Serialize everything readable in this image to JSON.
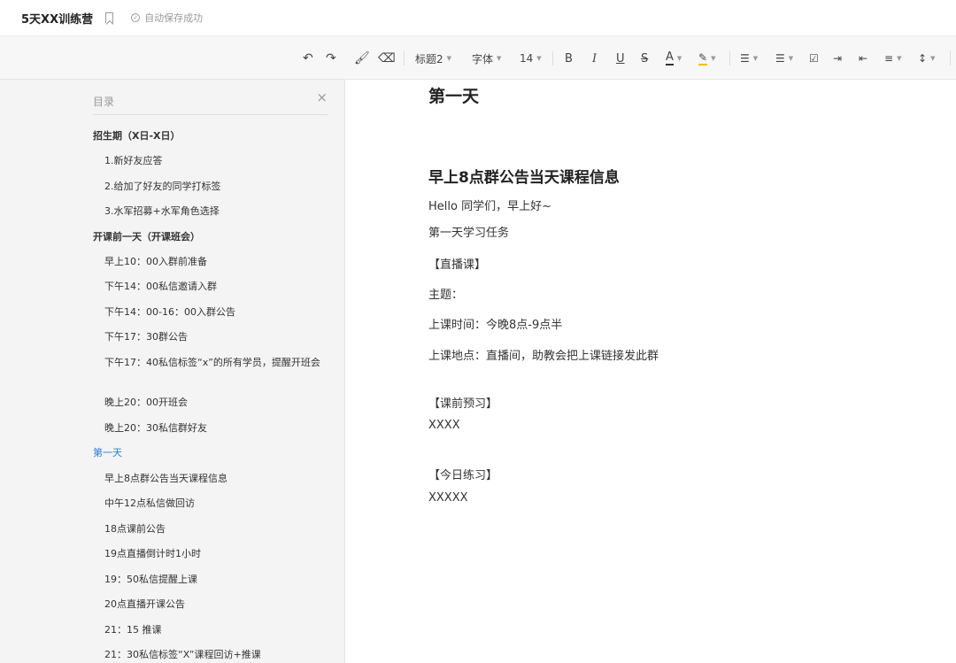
{
  "header": {
    "doc_title": "5天XX训练营",
    "save_status": "自动保存成功"
  },
  "toolbar": {
    "heading": "标题2",
    "font": "字体",
    "font_size": "14",
    "bold": "B",
    "italic": "I",
    "underline": "U",
    "strike": "S",
    "font_color": "A"
  },
  "toc": {
    "title": "目录",
    "items": [
      "招生期（X日-X日）",
      "1.新好友应答",
      "2.给加了好友的同学打标签",
      "3.水军招募+水军角色选择",
      "开课前一天（开课班会）",
      "早上10：00入群前准备",
      "下午14：00私信邀请入群",
      "下午14：00-16：00入群公告",
      "下午17：30群公告",
      "下午17：40私信标签“x”的所有学员，提醒开班会",
      "晚上20：00开班会",
      "晚上20：30私信群好友",
      "第一天",
      "早上8点群公告当天课程信息",
      "中午12点私信做回访",
      "18点课前公告",
      "19点直播倒计时1小时",
      "19：50私信提醒上课",
      "20点直播开课公告",
      "21：15 推课",
      "21：30私信标签“X”课程回访+推课"
    ]
  },
  "content": {
    "h1": "第一天",
    "h2": "早上8点群公告当天课程信息",
    "paragraphs": [
      "Hello 同学们，早上好~",
      "第一天学习任务",
      "【直播课】",
      "主题：",
      "上课时间：今晚8点-9点半",
      "上课地点：直播间，助教会把上课链接发此群",
      "【课前预习】",
      "XXXX",
      "【今日练习】",
      "XXXXX"
    ]
  }
}
